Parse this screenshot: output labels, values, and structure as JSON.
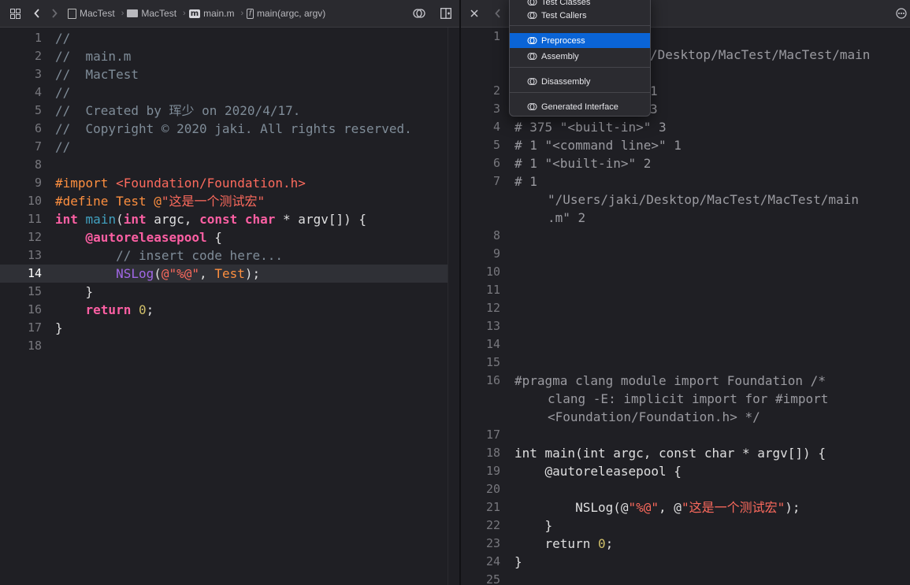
{
  "left_toolbar": {
    "breadcrumb": [
      "MacTest",
      "MacTest",
      "main.m",
      "main(argc, argv)"
    ]
  },
  "left_editor": {
    "lines": [
      {
        "n": "1",
        "parts": [
          {
            "t": "//",
            "c": "comment"
          }
        ]
      },
      {
        "n": "2",
        "parts": [
          {
            "t": "//  main.m",
            "c": "comment"
          }
        ]
      },
      {
        "n": "3",
        "parts": [
          {
            "t": "//  MacTest",
            "c": "comment"
          }
        ]
      },
      {
        "n": "4",
        "parts": [
          {
            "t": "//",
            "c": "comment"
          }
        ]
      },
      {
        "n": "5",
        "parts": [
          {
            "t": "//  Created by 珲少 on 2020/4/17.",
            "c": "comment"
          }
        ]
      },
      {
        "n": "6",
        "parts": [
          {
            "t": "//  Copyright © 2020 jaki. All rights reserved.",
            "c": "comment"
          }
        ]
      },
      {
        "n": "7",
        "parts": [
          {
            "t": "//",
            "c": "comment"
          }
        ]
      },
      {
        "n": "8",
        "parts": []
      },
      {
        "n": "9",
        "parts": [
          {
            "t": "#import ",
            "c": "prep"
          },
          {
            "t": "<Foundation/Foundation.h>",
            "c": "str"
          }
        ]
      },
      {
        "n": "10",
        "parts": [
          {
            "t": "#define Test @",
            "c": "prep"
          },
          {
            "t": "\"这是一个测试宏\"",
            "c": "str"
          }
        ]
      },
      {
        "n": "11",
        "parts": [
          {
            "t": "int",
            "c": "kw"
          },
          {
            "t": " ",
            "c": "plain"
          },
          {
            "t": "main",
            "c": "type"
          },
          {
            "t": "(",
            "c": "plain"
          },
          {
            "t": "int",
            "c": "kw"
          },
          {
            "t": " argc, ",
            "c": "plain"
          },
          {
            "t": "const",
            "c": "kw"
          },
          {
            "t": " ",
            "c": "plain"
          },
          {
            "t": "char",
            "c": "kw"
          },
          {
            "t": " * argv[]) {",
            "c": "plain"
          }
        ]
      },
      {
        "n": "12",
        "parts": [
          {
            "t": "    ",
            "c": "plain"
          },
          {
            "t": "@autoreleasepool",
            "c": "kw"
          },
          {
            "t": " {",
            "c": "plain"
          }
        ]
      },
      {
        "n": "13",
        "parts": [
          {
            "t": "        // insert code here...",
            "c": "comment"
          }
        ]
      },
      {
        "n": "14",
        "current": true,
        "parts": [
          {
            "t": "        ",
            "c": "plain"
          },
          {
            "t": "NSLog",
            "c": "func"
          },
          {
            "t": "(",
            "c": "plain"
          },
          {
            "t": "@\"%@\"",
            "c": "str"
          },
          {
            "t": ", ",
            "c": "plain"
          },
          {
            "t": "Test",
            "c": "macro"
          },
          {
            "t": ");",
            "c": "plain"
          }
        ]
      },
      {
        "n": "15",
        "parts": [
          {
            "t": "    }",
            "c": "plain"
          }
        ]
      },
      {
        "n": "16",
        "parts": [
          {
            "t": "    ",
            "c": "plain"
          },
          {
            "t": "return",
            "c": "kw"
          },
          {
            "t": " ",
            "c": "plain"
          },
          {
            "t": "0",
            "c": "num"
          },
          {
            "t": ";",
            "c": "plain"
          }
        ]
      },
      {
        "n": "17",
        "parts": [
          {
            "t": "}",
            "c": "plain"
          }
        ]
      },
      {
        "n": "18",
        "parts": []
      }
    ]
  },
  "right_editor": {
    "line_numbers": [
      {
        "n": "1",
        "row": 0
      },
      {
        "n": "2",
        "row": 3
      },
      {
        "n": "3",
        "row": 4
      },
      {
        "n": "4",
        "row": 5
      },
      {
        "n": "5",
        "row": 6
      },
      {
        "n": "6",
        "row": 7
      },
      {
        "n": "7",
        "row": 8
      },
      {
        "n": "8",
        "row": 11
      },
      {
        "n": "9",
        "row": 12
      },
      {
        "n": "10",
        "row": 13
      },
      {
        "n": "11",
        "row": 14
      },
      {
        "n": "12",
        "row": 15
      },
      {
        "n": "13",
        "row": 16
      },
      {
        "n": "14",
        "row": 17
      },
      {
        "n": "15",
        "row": 18
      },
      {
        "n": "16",
        "row": 19
      },
      {
        "n": "17",
        "row": 22
      },
      {
        "n": "18",
        "row": 23
      },
      {
        "n": "19",
        "row": 24
      },
      {
        "n": "20",
        "row": 25
      },
      {
        "n": "21",
        "row": 26
      },
      {
        "n": "22",
        "row": 27
      },
      {
        "n": "23",
        "row": 28
      },
      {
        "n": "24",
        "row": 29
      },
      {
        "n": "25",
        "row": 30
      }
    ],
    "code_rows": [
      {
        "row": 1,
        "indent": 1,
        "parts": [
          {
            "t": "/Desktop/MacTest/MacTest/main",
            "c": "plain",
            "dim": true
          }
        ]
      },
      {
        "row": 3,
        "indent": 1,
        "parts": [
          {
            "t": "1",
            "c": "plain",
            "dim": true
          }
        ]
      },
      {
        "row": 4,
        "indent": 1,
        "parts": [
          {
            "t": "3",
            "c": "plain",
            "dim": true
          }
        ]
      },
      {
        "row": 5,
        "parts": [
          {
            "t": "# 375 \"<built-in>\" 3",
            "c": "plain",
            "dim": true
          }
        ]
      },
      {
        "row": 6,
        "parts": [
          {
            "t": "# 1 \"<command line>\" 1",
            "c": "plain",
            "dim": true
          }
        ]
      },
      {
        "row": 7,
        "parts": [
          {
            "t": "# 1 \"<built-in>\" 2",
            "c": "plain",
            "dim": true
          }
        ]
      },
      {
        "row": 8,
        "parts": [
          {
            "t": "# 1",
            "c": "plain",
            "dim": true
          }
        ]
      },
      {
        "row": 9,
        "wrapped": true,
        "parts": [
          {
            "t": "\"/Users/jaki/Desktop/MacTest/MacTest/main",
            "c": "plain",
            "dim": true
          }
        ]
      },
      {
        "row": 10,
        "wrapped": true,
        "parts": [
          {
            "t": ".m\" 2",
            "c": "plain",
            "dim": true
          }
        ]
      },
      {
        "row": 19,
        "parts": [
          {
            "t": "#pragma clang module import Foundation /*",
            "c": "plain",
            "dim": true
          }
        ]
      },
      {
        "row": 20,
        "wrapped": true,
        "parts": [
          {
            "t": "clang -E: implicit import for #import",
            "c": "plain",
            "dim": true
          }
        ]
      },
      {
        "row": 21,
        "wrapped": true,
        "parts": [
          {
            "t": "<Foundation/Foundation.h> */",
            "c": "plain",
            "dim": true
          }
        ]
      },
      {
        "row": 23,
        "parts": [
          {
            "t": "int main(int argc, const char * argv[]) {",
            "c": "plain"
          }
        ]
      },
      {
        "row": 24,
        "parts": [
          {
            "t": "    @autoreleasepool {",
            "c": "plain"
          }
        ]
      },
      {
        "row": 26,
        "parts": [
          {
            "t": "        NSLog(@",
            "c": "plain"
          },
          {
            "t": "\"%@\"",
            "c": "str"
          },
          {
            "t": ", @",
            "c": "plain"
          },
          {
            "t": "\"这是一个测试宏\"",
            "c": "str"
          },
          {
            "t": ");",
            "c": "plain"
          }
        ]
      },
      {
        "row": 27,
        "parts": [
          {
            "t": "    }",
            "c": "plain"
          }
        ]
      },
      {
        "row": 28,
        "parts": [
          {
            "t": "    return ",
            "c": "plain"
          },
          {
            "t": "0",
            "c": "num"
          },
          {
            "t": ";",
            "c": "plain"
          }
        ]
      },
      {
        "row": 29,
        "parts": [
          {
            "t": "}",
            "c": "plain"
          }
        ]
      }
    ]
  },
  "popup_menu": {
    "items": [
      {
        "label": "Test Classes",
        "partial": true
      },
      {
        "label": "Test Callers"
      },
      {
        "label": "Preprocess",
        "selected": true
      },
      {
        "label": "Assembly"
      },
      {
        "label": "Disassembly"
      },
      {
        "label": "Generated Interface"
      }
    ]
  },
  "colors": {
    "comment": "#7f8c98",
    "keyword": "#fc5fa3",
    "string": "#fc6a5d",
    "preprocessor": "#fd8f3f",
    "number": "#d0bf69",
    "function": "#a167e6",
    "type": "#41a1c0",
    "selection": "#0a64d6"
  },
  "icons": [
    "grid-icon",
    "back-chevron-icon",
    "forward-chevron-icon",
    "folder-icon",
    "m-file-icon",
    "function-icon",
    "related-items-icon",
    "add-editor-icon",
    "close-icon",
    "more-icon",
    "menu-item-icon"
  ]
}
